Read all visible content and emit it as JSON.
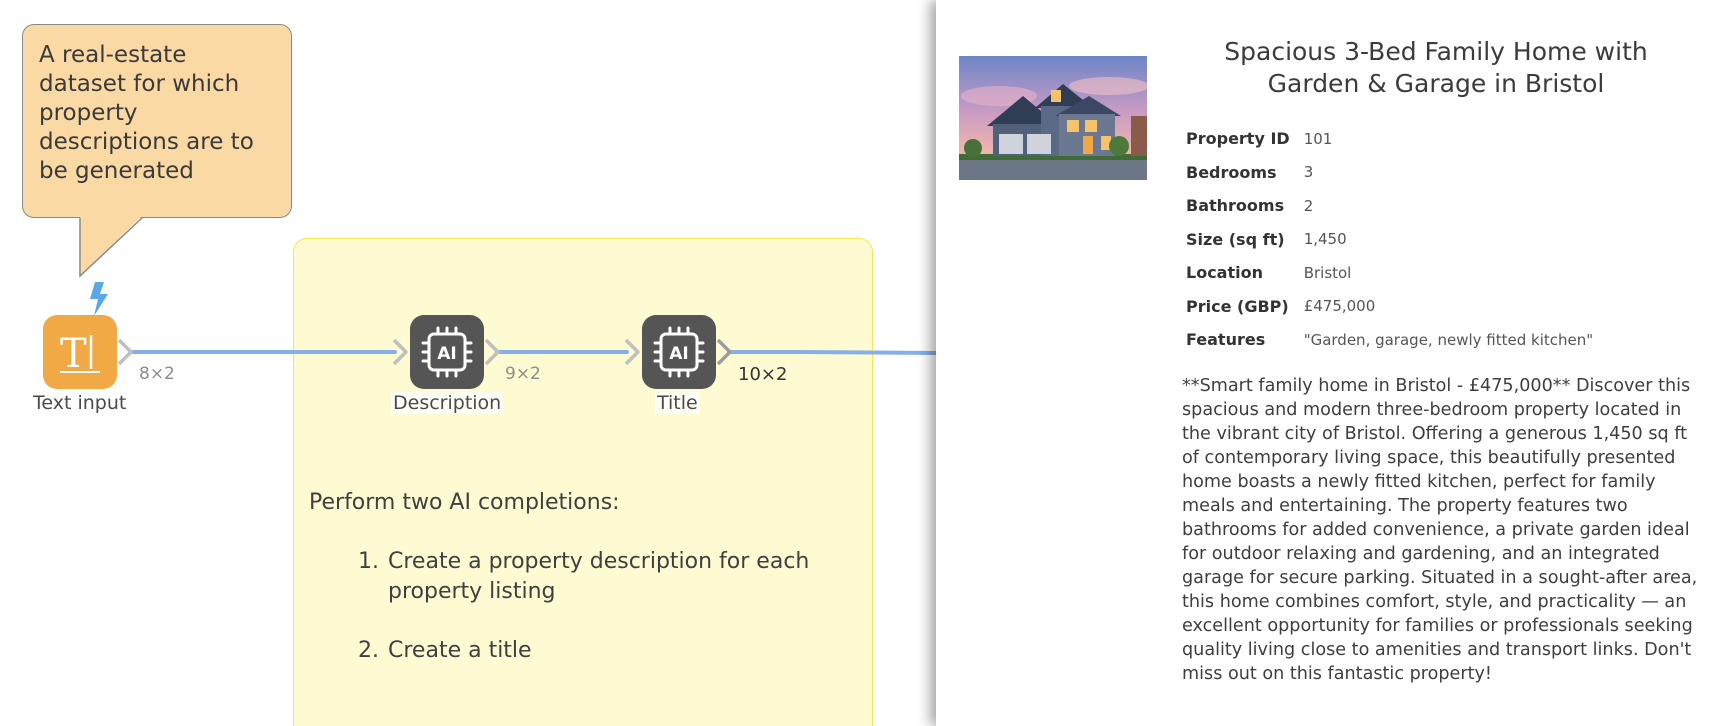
{
  "callout": {
    "text": "A real-estate dataset for which property descriptions are to be generated"
  },
  "nodes": {
    "text_input": {
      "label": "Text input",
      "icon": "text-input-icon",
      "glyph": "T|",
      "color": "#f0a944"
    },
    "description": {
      "label": "Description",
      "icon": "ai-chip-icon",
      "glyph": "AI"
    },
    "title": {
      "label": "Title",
      "icon": "ai-chip-icon",
      "glyph": "AI"
    }
  },
  "shapes": {
    "after_text_input": "8×2",
    "after_description": "9×2",
    "after_title": "10×2"
  },
  "note": {
    "intro": "Perform two AI completions:",
    "items": [
      {
        "num": "1.",
        "text": "Create a property description for each property listing"
      },
      {
        "num": "2.",
        "text": "Create a title"
      }
    ]
  },
  "panel": {
    "image_alt": "house-photo",
    "title": "Spacious 3-Bed Family Home with Garden & Garage in Bristol",
    "fields": [
      {
        "key": "Property ID",
        "value": "101"
      },
      {
        "key": "Bedrooms",
        "value": "3"
      },
      {
        "key": "Bathrooms",
        "value": "2"
      },
      {
        "key": "Size (sq ft)",
        "value": "1,450"
      },
      {
        "key": "Location",
        "value": "Bristol"
      },
      {
        "key": "Price (GBP)",
        "value": "£475,000"
      },
      {
        "key": "Features",
        "value": "\"Garden, garage, newly fitted kitchen\""
      }
    ],
    "description": "**Smart family home in Bristol - £475,000** Discover this spacious and modern three-bedroom property located in the vibrant city of Bristol. Offering a generous 1,450 sq ft of contemporary living space, this beautifully presented home boasts a newly fitted kitchen, perfect for family meals and entertaining. The property features two bathrooms for added convenience, a private garden ideal for outdoor relaxing and gardening, and an integrated garage for secure parking. Situated in a sought-after area, this home combines comfort, style, and practicality — an excellent opportunity for families or professionals seeking quality living close to amenities and transport links. Don't miss out on this fantastic property!"
  },
  "colors": {
    "wire": "#86aee8",
    "text_input_node": "#f0a944",
    "ai_node": "#555555",
    "callout_fill": "#fbd9a4",
    "note_fill": "#fefbd2",
    "note_border": "#f5e84a",
    "trigger_bolt": "#5aa8e6"
  }
}
